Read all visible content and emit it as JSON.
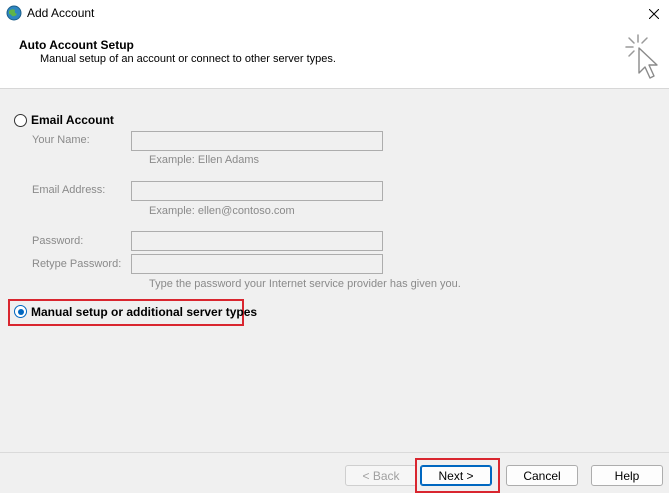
{
  "window": {
    "title": "Add Account",
    "close_icon": "close-icon"
  },
  "header": {
    "title": "Auto Account Setup",
    "subtitle": "Manual setup of an account or connect to other server types."
  },
  "email_account": {
    "label": "Email Account",
    "selected": false,
    "fields": {
      "name_label": "Your Name:",
      "name_value": "",
      "name_hint": "Example: Ellen Adams",
      "email_label": "Email Address:",
      "email_value": "",
      "email_hint": "Example: ellen@contoso.com",
      "password_label": "Password:",
      "password_value": "",
      "retype_label": "Retype Password:",
      "retype_value": "",
      "password_hint": "Type the password your Internet service provider has given you."
    }
  },
  "manual_setup": {
    "label": "Manual setup or additional server types",
    "selected": true
  },
  "buttons": {
    "back": "< Back",
    "next": "Next >",
    "cancel": "Cancel",
    "help": "Help"
  },
  "colors": {
    "accent": "#0067c0",
    "highlight": "#d9262f"
  }
}
